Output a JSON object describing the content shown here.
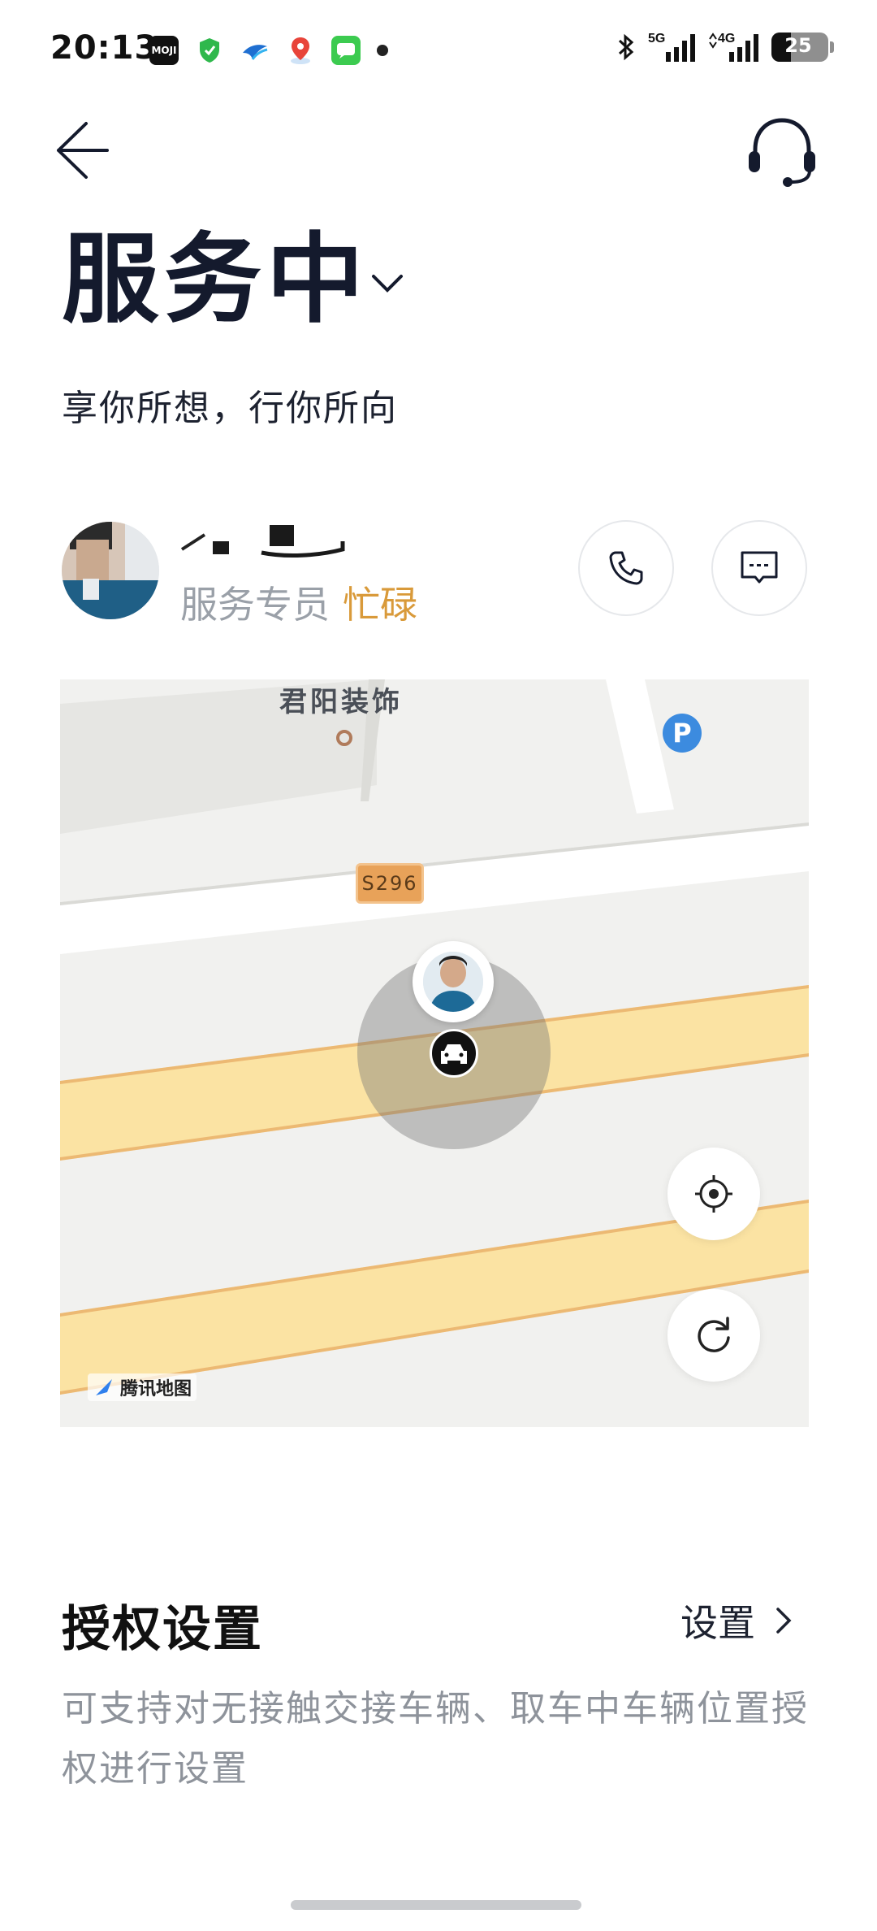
{
  "status_bar": {
    "time": "20:13",
    "notification_icons": [
      "moji-weather-icon",
      "shield-icon",
      "bird-icon",
      "map-pin-icon",
      "messages-icon",
      "dot-icon"
    ],
    "moji_label": "MOJI",
    "network_1": "5G",
    "network_2": "4G",
    "battery": "25"
  },
  "header": {
    "title": "服务中",
    "subtitle": "享你所想，行你所向"
  },
  "agent": {
    "role": "服务专员",
    "status": "忙碌",
    "status_color": "#d99a3a"
  },
  "map": {
    "poi_name": "君阳装饰",
    "road_shield": "S296",
    "parking_symbol": "P",
    "provider": "腾讯地图",
    "road_color": "#fbe3a3"
  },
  "authorization": {
    "title": "授权设置",
    "link_label": "设置",
    "description": "可支持对无接触交接车辆、取车中车辆位置授权进行设置"
  }
}
